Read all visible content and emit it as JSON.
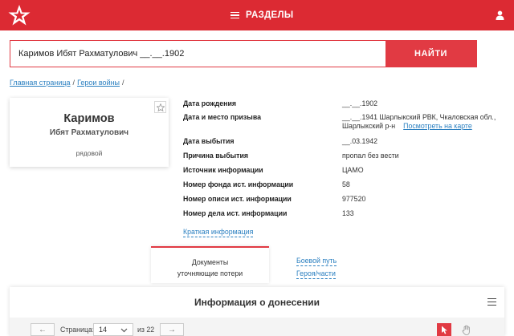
{
  "header": {
    "menu_label": "РАЗДЕЛЫ",
    "brand_color": "#dc2a33"
  },
  "search": {
    "value": "Каримов Ибят Рахматулович __.__.1902",
    "button_label": "НАЙТИ"
  },
  "breadcrumb": {
    "items": [
      "Главная страница",
      "Герои войны"
    ],
    "separator": "/"
  },
  "person": {
    "surname": "Каримов",
    "given_names": "Ибят Рахматулович",
    "rank": "рядовой"
  },
  "info": {
    "rows": [
      {
        "label": "Дата рождения",
        "value": "__.__.1902"
      },
      {
        "label": "Дата и место призыва",
        "value": "__.__.1941 Шарлыкский РВК, Чкаловская обл.,",
        "value2": "Шарлыкский р-н",
        "link": "Посмотреть на карте"
      },
      {
        "label": "Дата выбытия",
        "value": "__.03.1942"
      },
      {
        "label": "Причина выбытия",
        "value": "пропал без вести"
      },
      {
        "label": "Источник информации",
        "value": "ЦАМО"
      },
      {
        "label": "Номер фонда ист. информации",
        "value": "58"
      },
      {
        "label": "Номер описи ист. информации",
        "value": "977520"
      },
      {
        "label": "Номер дела ист. информации",
        "value": "133"
      }
    ],
    "short_info_link": "Краткая информация"
  },
  "tabs": {
    "active_line1": "Документы",
    "active_line2": "уточняющие потери",
    "combat_path": "Боевой путь",
    "hero_unit": "Героя/части"
  },
  "report": {
    "title": "Информация о донесении",
    "page_label": "Страница:",
    "current_page": "14",
    "of_label": "из 22"
  }
}
